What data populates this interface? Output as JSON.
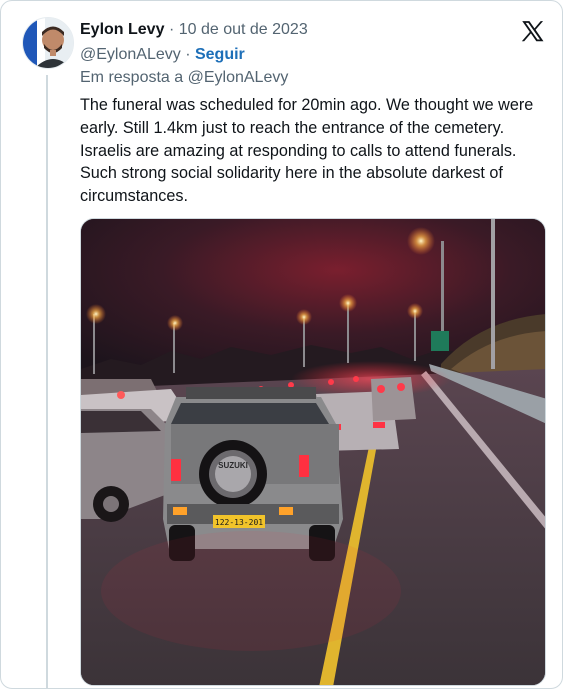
{
  "author": {
    "name": "Eylon Levy",
    "handle": "@EylonALevy",
    "date": "10 de out de 2023",
    "avatar_icon": "profile-avatar-icon"
  },
  "actions": {
    "follow_label": "Seguir",
    "separator": "·"
  },
  "reply": {
    "label": "Em resposta a",
    "handle": "@EylonALevy"
  },
  "tweet": {
    "text": "The funeral was scheduled for 20min ago. We thought we were early. Still 1.4km just to reach the entrance of the cemetery. Israelis are amazing at responding to calls to attend funerals. Such strong social solidarity here in the absolute darkest of circumstances."
  },
  "media": {
    "brand_text": "SUZUKI",
    "plate_text": "122-13-201",
    "sky_color": "#2b1a24",
    "glow_color": "#c81e38"
  },
  "brand": {
    "logo_icon": "x-logo-icon",
    "text_color": "#0f1419",
    "link_color": "#1d6fb8",
    "muted_color": "#536471"
  }
}
